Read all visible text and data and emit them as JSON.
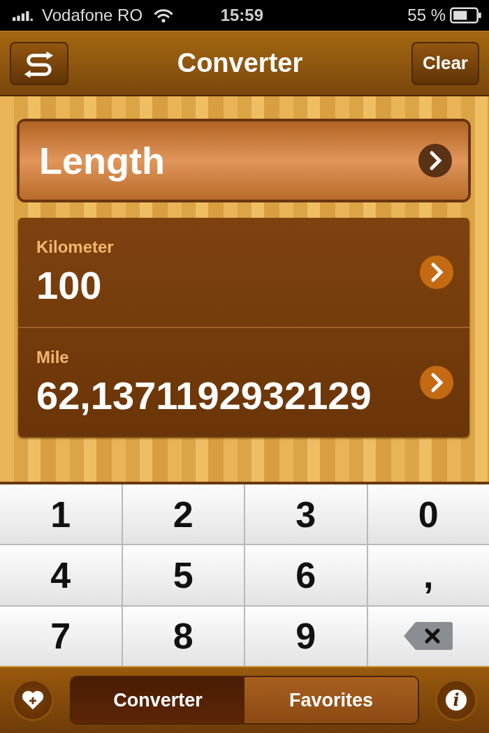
{
  "status_bar": {
    "carrier": "Vodafone RO",
    "time": "15:59",
    "battery": "55 %"
  },
  "nav_bar": {
    "title": "Converter",
    "right_button": "Clear"
  },
  "category": {
    "label": "Length"
  },
  "units": [
    {
      "name": "Kilometer",
      "value": "100"
    },
    {
      "name": "Mile",
      "value": "62,1371192932129"
    }
  ],
  "keypad": [
    {
      "kind": "key",
      "label": "1"
    },
    {
      "kind": "key",
      "label": "2"
    },
    {
      "kind": "key",
      "label": "3"
    },
    {
      "kind": "key",
      "label": "0"
    },
    {
      "kind": "key",
      "label": "4"
    },
    {
      "kind": "key",
      "label": "5"
    },
    {
      "kind": "key",
      "label": "6"
    },
    {
      "kind": "key",
      "label": ","
    },
    {
      "kind": "key",
      "label": "7"
    },
    {
      "kind": "key",
      "label": "8"
    },
    {
      "kind": "key",
      "label": "9"
    },
    {
      "kind": "backspace"
    }
  ],
  "tab_bar": {
    "tabs": [
      {
        "label": "Converter",
        "selected": true
      },
      {
        "label": "Favorites",
        "selected": false
      }
    ],
    "info_button": "i"
  }
}
